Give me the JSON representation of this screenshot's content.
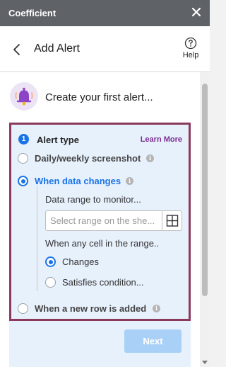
{
  "titlebar": {
    "title": "Coefficient"
  },
  "header": {
    "title": "Add Alert",
    "help_label": "Help"
  },
  "intro": {
    "text": "Create your first alert..."
  },
  "alert_type": {
    "step_number": "1",
    "label": "Alert type",
    "learn_more": "Learn More",
    "options": [
      {
        "label": "Daily/weekly screenshot",
        "selected": false
      },
      {
        "label": "When data changes",
        "selected": true
      },
      {
        "label": "When a new row is added",
        "selected": false
      }
    ],
    "data_changes": {
      "range_label": "Data range to monitor...",
      "range_placeholder": "Select range on the she...",
      "cell_label": "When any cell in the range..",
      "cell_options": [
        {
          "label": "Changes",
          "selected": true
        },
        {
          "label": "Satisfies condition...",
          "selected": false
        }
      ]
    }
  },
  "footer": {
    "next_label": "Next"
  },
  "colors": {
    "accent": "#1a73e8",
    "brand": "#7b2c91",
    "card_border": "#8b3a5e",
    "card_bg": "#e7f1fc",
    "next_disabled": "#a9d1f7"
  }
}
